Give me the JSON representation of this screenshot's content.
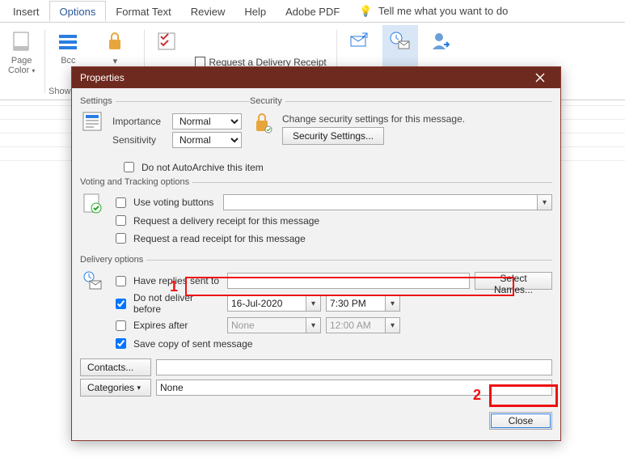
{
  "tabs": {
    "insert": "Insert",
    "options": "Options",
    "format": "Format Text",
    "review": "Review",
    "help": "Help",
    "adobe": "Adobe PDF",
    "tellme": "Tell me what you want to do"
  },
  "ribbon": {
    "pagecolor": "Page Color",
    "bcc": "Bcc",
    "requestDelivery": "Request a Delivery Receipt",
    "show": "Show"
  },
  "dialog": {
    "title": "Properties",
    "groups": {
      "settings": "Settings",
      "security": "Security",
      "voting": "Voting and Tracking options",
      "delivery": "Delivery options"
    },
    "settings": {
      "importance": "Importance",
      "importanceValue": "Normal",
      "sensitivity": "Sensitivity",
      "sensitivityValue": "Normal",
      "noAutoArchive": "Do not AutoArchive this item"
    },
    "security": {
      "msg": "Change security settings for this message.",
      "btn": "Security Settings..."
    },
    "voting": {
      "useVoting": "Use voting buttons",
      "deliveryReceipt": "Request a delivery receipt for this message",
      "readReceipt": "Request a read receipt for this message"
    },
    "delivery": {
      "replies": "Have replies sent to",
      "selectNames": "Select Names...",
      "noDeliverBefore": "Do not deliver before",
      "dateValue": "16-Jul-2020",
      "timeValue": "7:30 PM",
      "expiresAfter": "Expires after",
      "expiresDate": "None",
      "expiresTime": "12:00 AM",
      "saveCopy": "Save copy of sent message",
      "contacts": "Contacts...",
      "categories": "Categories",
      "categoriesValue": "None"
    },
    "close": "Close"
  },
  "annotations": {
    "n1": "1",
    "n2": "2"
  }
}
